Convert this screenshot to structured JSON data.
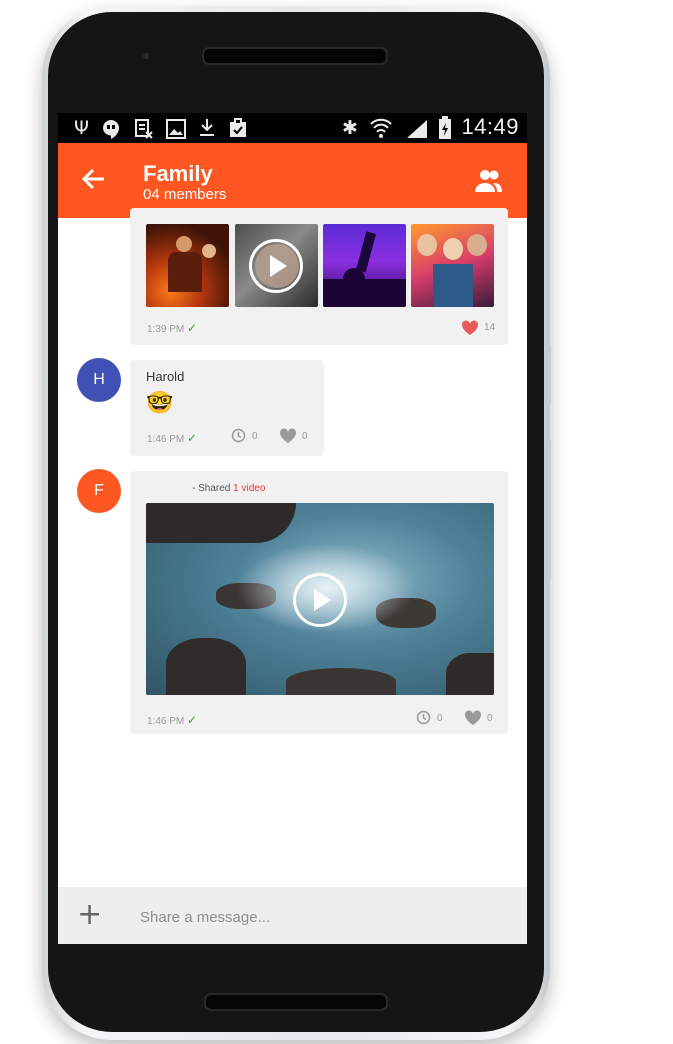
{
  "status_bar": {
    "time": "14:49",
    "left_icons": [
      "usb-icon",
      "hangouts-icon",
      "no-sim-icon",
      "gallery-icon",
      "download-icon",
      "clipboard-icon"
    ],
    "right_icons": [
      "bluetooth-icon",
      "wifi-icon",
      "signal-icon",
      "battery-icon"
    ]
  },
  "header": {
    "title": "Family",
    "subtitle": "04 members",
    "back_icon": "arrow-back-icon",
    "members_icon": "group-icon",
    "color": "#ff5722"
  },
  "messages": [
    {
      "type": "photos",
      "time": "1:39 PM",
      "likes": "14",
      "liked": true,
      "photos": [
        "party-bar-photo",
        "video-selfie-photo",
        "concert-crowd-photo",
        "friends-party-photo"
      ]
    },
    {
      "type": "text",
      "sender_initial": "H",
      "sender_name": "Harold",
      "avatar_color": "#3f51b5",
      "emoji": "🤓",
      "time": "1:46 PM",
      "views": "0",
      "likes": "0"
    },
    {
      "type": "video",
      "sender_initial": "F",
      "avatar_color": "#ff5722",
      "shared_prefix": "- Shared",
      "shared_count": "1 video",
      "time": "1:46 PM",
      "views": "0",
      "likes": "0"
    }
  ],
  "composer": {
    "add_icon": "plus-icon",
    "placeholder": "Share a message..."
  }
}
